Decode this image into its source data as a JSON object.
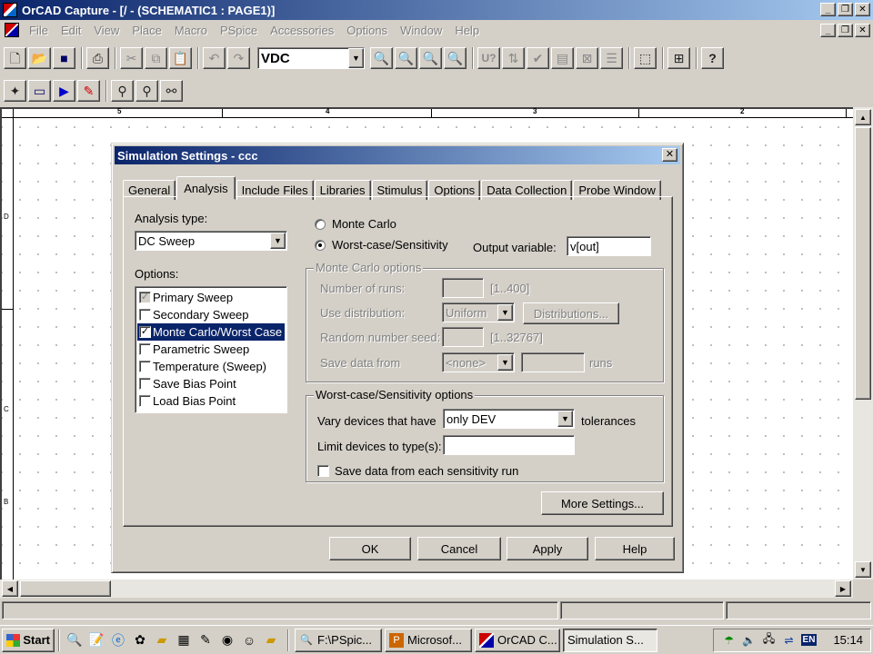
{
  "window": {
    "title": "OrCAD Capture - [/ - (SCHEMATIC1 : PAGE1)]",
    "caption_buttons": [
      "_",
      "❐",
      "✕"
    ]
  },
  "menu": {
    "items": [
      "File",
      "Edit",
      "View",
      "Place",
      "Macro",
      "PSpice",
      "Accessories",
      "Options",
      "Window",
      "Help"
    ],
    "doc_buttons": [
      "_",
      "❐",
      "✕"
    ]
  },
  "toolbar": {
    "part_combo_value": "VDC",
    "u_label": "U?"
  },
  "ruler": {
    "labels": [
      "5",
      "4",
      "3",
      "2"
    ],
    "left_marks": [
      "D",
      "C",
      "B"
    ]
  },
  "dialog": {
    "title": "Simulation Settings - ccc",
    "close": "✕",
    "tabs": [
      "General",
      "Analysis",
      "Include Files",
      "Libraries",
      "Stimulus",
      "Options",
      "Data Collection",
      "Probe Window"
    ],
    "active_tab": 1,
    "analysis_type_label": "Analysis type:",
    "analysis_type_value": "DC Sweep",
    "options_label": "Options:",
    "options": [
      {
        "label": "Primary Sweep",
        "checked": "✓",
        "state": "greyed"
      },
      {
        "label": "Secondary Sweep",
        "checked": "",
        "state": "normal"
      },
      {
        "label": "Monte Carlo/Worst Case",
        "checked": "✓",
        "state": "selected"
      },
      {
        "label": "Parametric Sweep",
        "checked": "",
        "state": "normal"
      },
      {
        "label": "Temperature (Sweep)",
        "checked": "",
        "state": "normal"
      },
      {
        "label": "Save Bias Point",
        "checked": "",
        "state": "normal"
      },
      {
        "label": "Load Bias Point",
        "checked": "",
        "state": "normal"
      }
    ],
    "radio_monte_carlo": "Monte Carlo",
    "radio_worst_case": "Worst-case/Sensitivity",
    "selected_radio": "worst_case",
    "output_variable_label": "Output variable:",
    "output_variable_value": "v[out]",
    "monte_carlo": {
      "group_title": "Monte Carlo options",
      "runs_label": "Number of runs:",
      "runs_value": "",
      "runs_range": "[1..400]",
      "distribution_label": "Use distribution:",
      "distribution_value": "Uniform",
      "distributions_button": "Distributions...",
      "seed_label": "Random number seed:",
      "seed_value": "",
      "seed_range": "[1..32767]",
      "save_label": "Save data from",
      "save_value": "<none>",
      "save_runs_value": "",
      "runs_unit": "runs"
    },
    "worst_case": {
      "group_title": "Worst-case/Sensitivity options",
      "vary_label": "Vary devices that have",
      "vary_value": "only DEV",
      "tolerances_label": "tolerances",
      "limit_label": "Limit devices to type(s):",
      "limit_value": "",
      "save_each_label": "Save data from each sensitivity run",
      "save_each_checked": ""
    },
    "more_settings": "More Settings...",
    "buttons": {
      "ok": "OK",
      "cancel": "Cancel",
      "apply": "Apply",
      "help": "Help"
    }
  },
  "taskbar": {
    "start": "Start",
    "tasks": [
      "F:\\PSpic...",
      "Microsof...",
      "OrCAD C...",
      "Simulation S..."
    ],
    "active_task": 3,
    "language": "EN",
    "clock": "15:14"
  }
}
